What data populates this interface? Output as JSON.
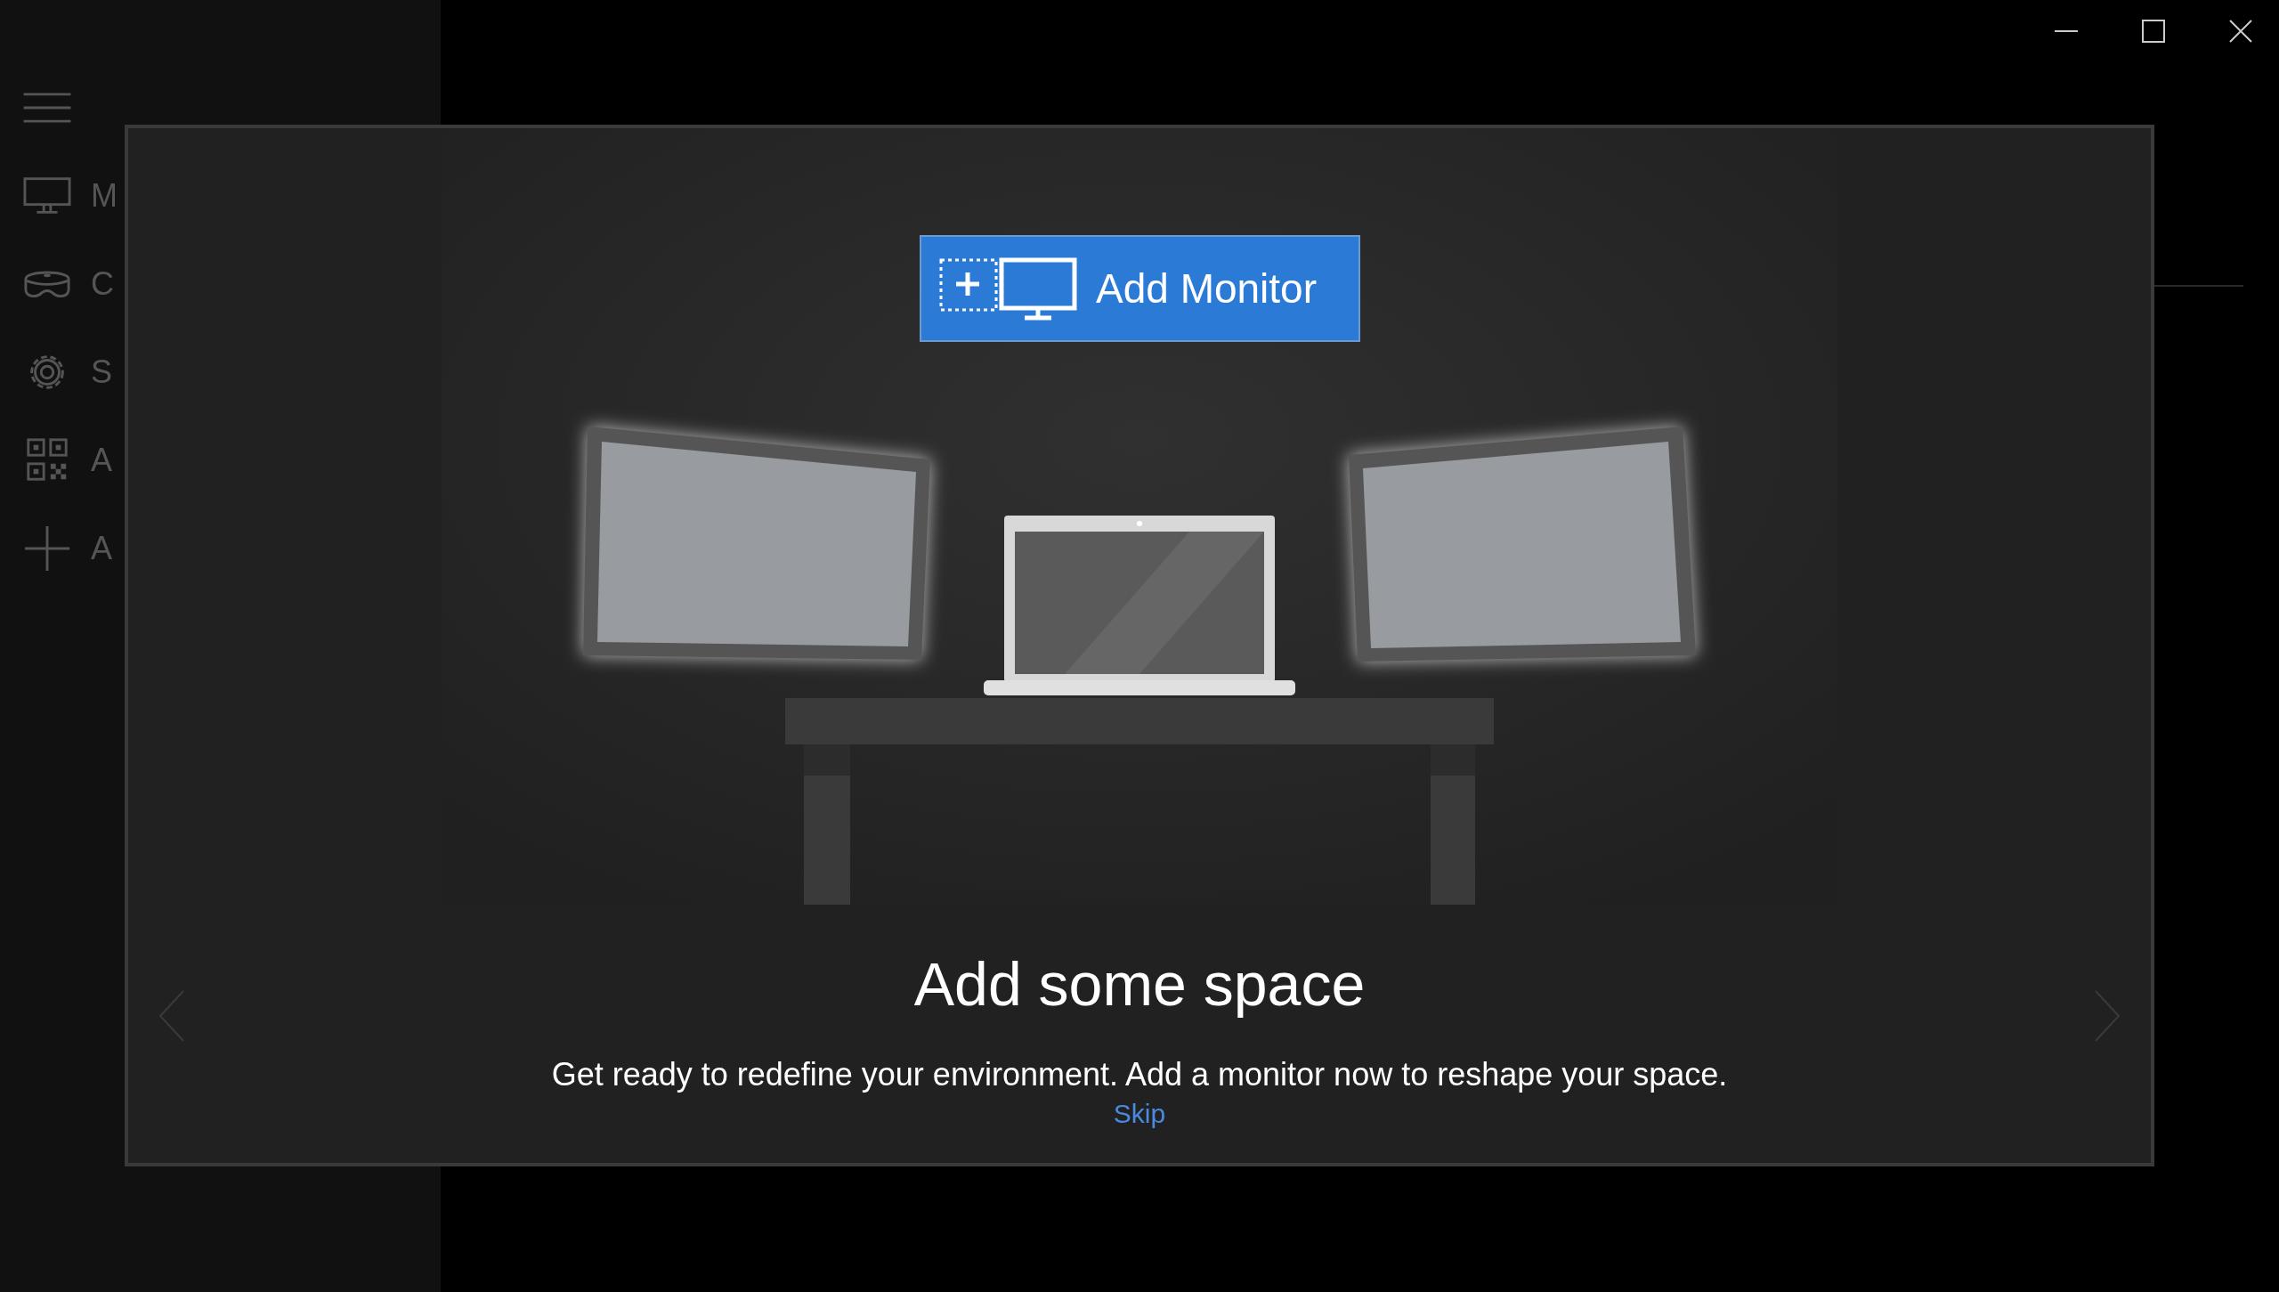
{
  "sidebar": {
    "items": [
      {
        "label": "M"
      },
      {
        "label": "C"
      },
      {
        "label": "S"
      },
      {
        "label": "A"
      },
      {
        "label": "A"
      }
    ]
  },
  "dialog": {
    "button": "Add Monitor",
    "title": "Add some space",
    "text": "Get ready to redefine your environment. Add a monitor now to reshape your space.",
    "link": "Skip"
  }
}
